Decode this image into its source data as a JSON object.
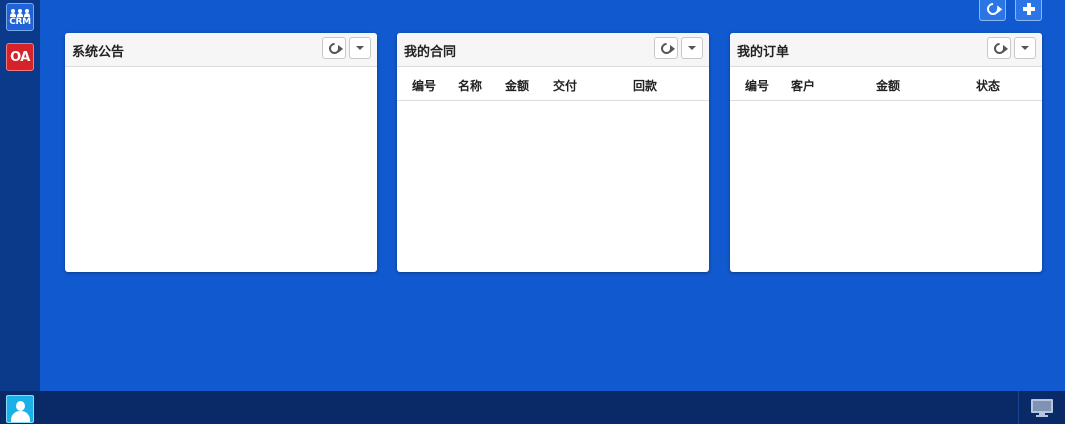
{
  "sidebar": {
    "apps": [
      {
        "id": "crm",
        "label": "CRM",
        "icon": "crm-people-icon",
        "color": "#1f63d6"
      },
      {
        "id": "oa",
        "label": "OA",
        "icon": "oa-icon",
        "color": "#d6232a"
      },
      {
        "id": "grid",
        "label": "",
        "icon": "app-grid-icon"
      }
    ]
  },
  "toolbar": {
    "refresh_icon": "refresh-icon",
    "add_icon": "plus-icon"
  },
  "panels": {
    "notice": {
      "title": "系统公告"
    },
    "contract": {
      "title": "我的合同",
      "columns": [
        "编号",
        "名称",
        "金额",
        "交付",
        "回款"
      ]
    },
    "order": {
      "title": "我的订单",
      "columns": [
        "编号",
        "客户",
        "金额",
        "状态"
      ]
    }
  },
  "bottombar": {
    "user_icon": "user-avatar-icon",
    "desktop_icon": "desktop-monitor-icon"
  },
  "colors": {
    "background": "#1159cf",
    "sidebar": "#0b3a8a",
    "bottombar": "#0a2a67"
  }
}
